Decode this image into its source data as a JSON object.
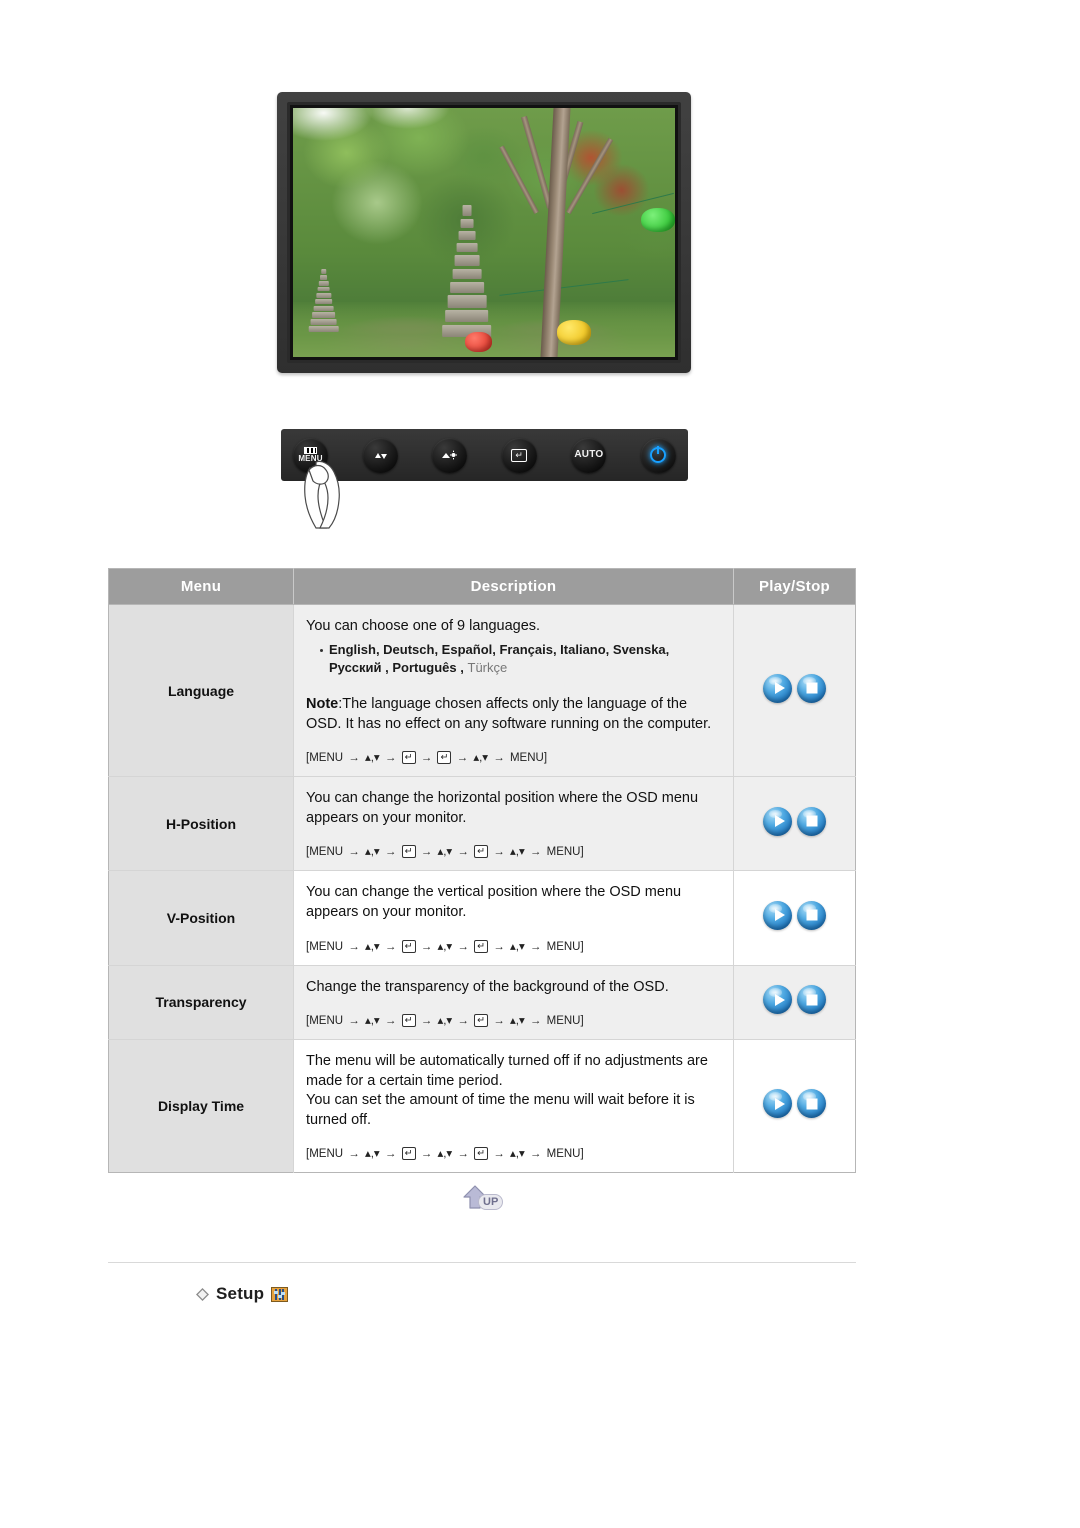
{
  "monitor": {
    "screen_alt": "garden-photo-with-pagoda-and-lanterns",
    "controls": [
      {
        "name": "menu-button",
        "label": "MENU",
        "glyph": "menu-bars-icon"
      },
      {
        "name": "down-button",
        "label": "",
        "glyph": "volume-down-icon"
      },
      {
        "name": "brightness-button",
        "label": "",
        "glyph": "brightness-up-icon"
      },
      {
        "name": "enter-button",
        "label": "",
        "glyph": "enter-icon"
      },
      {
        "name": "auto-button",
        "label": "AUTO",
        "glyph": "auto-text-icon"
      },
      {
        "name": "power-button",
        "label": "",
        "glyph": "power-icon"
      }
    ]
  },
  "table": {
    "headers": {
      "menu": "Menu",
      "description": "Description",
      "playstop": "Play/Stop"
    },
    "rows": [
      {
        "menu": "Language",
        "intro": "You can choose one of 9 languages.",
        "languages_line1": "English, Deutsch, Español, Français,  Italiano, Svenska,",
        "languages_line2_bold": "Русский , Português ,",
        "languages_line2_faint": "Türkçe",
        "note_label": "Note",
        "note_text": ":The language chosen affects only the language of the OSD. It has no effect on any software running on the computer.",
        "path": "[MENU → ▲,▼ → ENTER → ENTER → ▲,▼ → MENU]",
        "path_tokens": [
          "[MENU",
          "→",
          "▲,▼",
          "→",
          "ENTER",
          "→",
          "ENTER",
          "→",
          "▲,▼",
          "→",
          "MENU]"
        ],
        "shaded": true
      },
      {
        "menu": "H-Position",
        "desc": "You can change the horizontal position where the OSD menu appears on your monitor.",
        "path": "[MENU → ▲,▼ → ENTER → ▲,▼ → ENTER → ▲,▼ → MENU]",
        "shaded": true
      },
      {
        "menu": "V-Position",
        "desc": "You can change the vertical position where the OSD menu appears on your monitor.",
        "path": "[MENU → ▲,▼ → ENTER → ▲,▼ → ENTER → ▲,▼ → MENU]",
        "shaded": false
      },
      {
        "menu": "Transparency",
        "desc": "Change the transparency of the background of the OSD.",
        "path": "[MENU → ▲,▼ → ENTER → ▲,▼ → ENTER → ▲,▼ → MENU]",
        "shaded": true
      },
      {
        "menu": "Display Time",
        "desc_line1": "The menu will be automatically turned off if no adjustments are made for a certain time period.",
        "desc_line2": "You can set the amount of time the menu will wait before it is turned off.",
        "path": "[MENU → ▲,▼ → ENTER → ▲,▼ → ENTER → ▲,▼ → MENU]",
        "shaded": false
      }
    ],
    "play_label": "play-button",
    "stop_label": "stop-button"
  },
  "up_button": {
    "label": "UP"
  },
  "setup": {
    "label": "Setup",
    "icon": "setup-sliders-icon"
  },
  "colors": {
    "header_bg": "#9d9d9d",
    "menu_col_bg": "#e0e0e0",
    "row_shade_bg": "#efefef",
    "orb_blue": "#1d76c0",
    "setup_icon_bg": "#e8a33d",
    "up_badge": "#6f6f8e"
  }
}
